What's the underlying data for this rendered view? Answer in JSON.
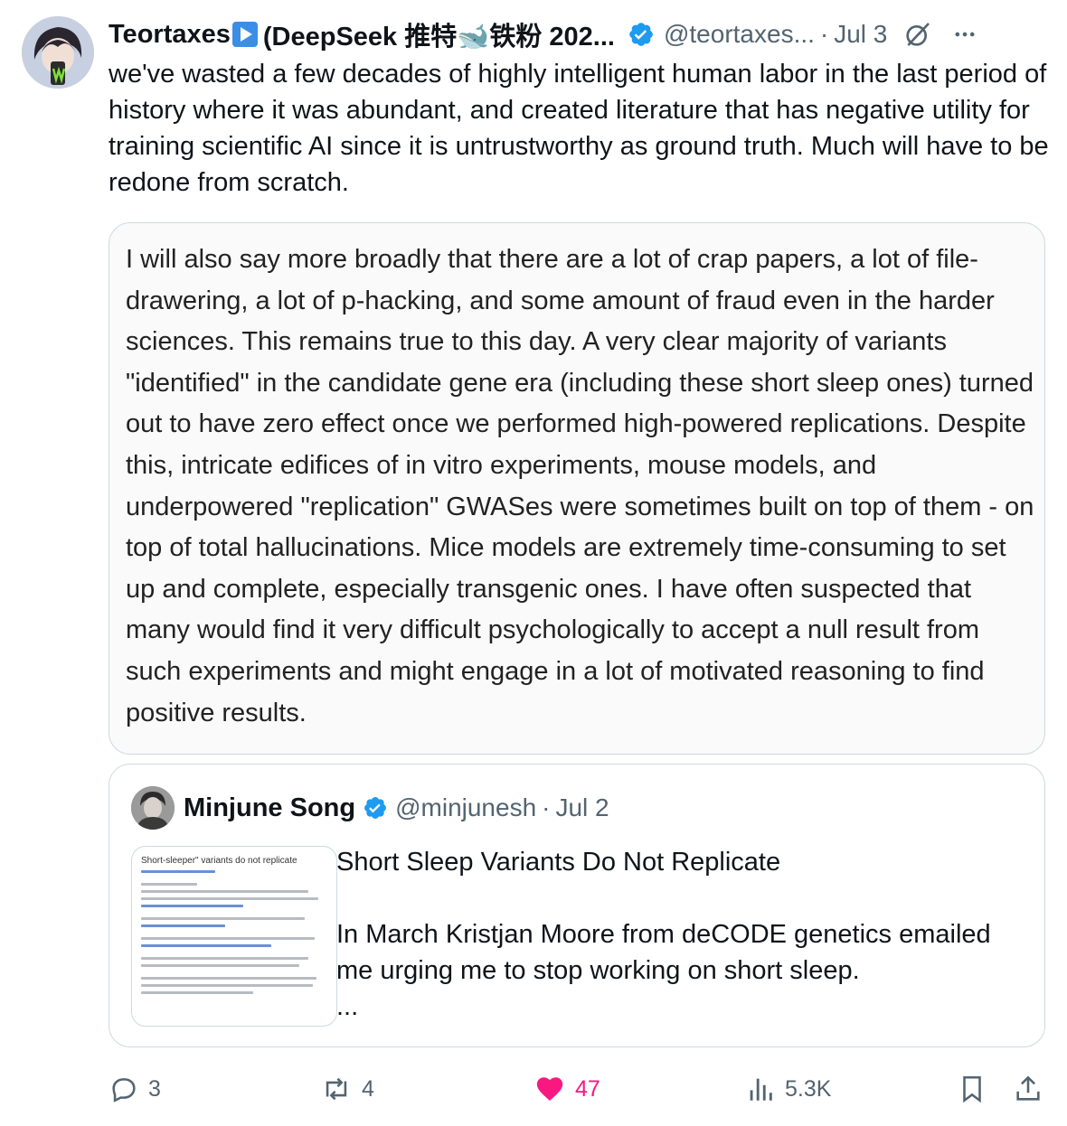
{
  "author": {
    "display_name_prefix": "Teortaxes",
    "display_name_suffix": "(DeepSeek 推特🐋铁粉 202...",
    "handle": "@teortaxes...",
    "separator": "·",
    "date": "Jul 3"
  },
  "tweet": {
    "text": "we've wasted a few decades of highly intelligent human labor in the last period of history where it was abundant, and created literature that has negative utility for training scientific AI since it is untrustworthy as ground truth. Much will have to be redone from scratch."
  },
  "image_card": {
    "text": "I will also say more broadly that there are a lot of crap papers, a lot of file-drawering, a lot of p-hacking, and some amount of fraud even in the harder sciences. This remains true to this day. A very clear majority of variants \"identified\" in the candidate gene era (including these short sleep ones) turned out to have zero effect once we performed high-powered replications. Despite this, intricate edifices of in vitro experiments, mouse models, and underpowered \"replication\" GWASes were sometimes built on top of them - on top of total hallucinations. Mice models are extremely time-consuming to set up and complete, especially transgenic ones. I have often suspected that many would find it very difficult psychologically to accept a null result from such experiments and might engage in a lot of motivated reasoning to find positive results."
  },
  "quote": {
    "display_name": "Minjune Song",
    "handle": "@minjunesh",
    "separator": "·",
    "date": "Jul 2",
    "thumbnail_title": "Short-sleeper\" variants do not replicate",
    "title": "Short Sleep Variants Do Not Replicate",
    "body": "In March Kristjan Moore from deCODE genetics emailed me urging me to stop working on short sleep.",
    "ellipsis": "..."
  },
  "actions": {
    "replies": "3",
    "reposts": "4",
    "likes": "47",
    "views": "5.3K"
  },
  "colors": {
    "verified": "#1d9bf0",
    "like": "#f91880",
    "secondary_text": "#536471",
    "border": "#cfd9de"
  }
}
